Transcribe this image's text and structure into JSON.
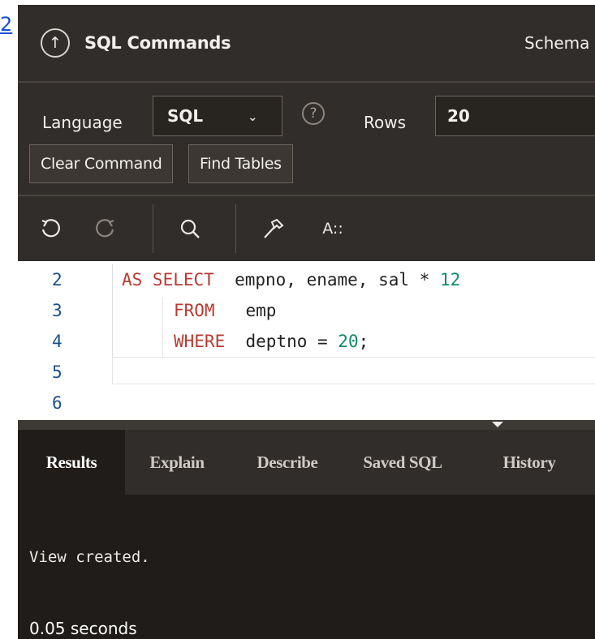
{
  "page_fragment": "2",
  "header": {
    "title": "SQL Commands",
    "schema_label": "Schema",
    "up_icon": "arrow-up-circle-icon"
  },
  "toolbar": {
    "language_label": "Language",
    "language_value": "SQL",
    "help_glyph": "?",
    "rows_label": "Rows",
    "rows_value": "20",
    "clear_command_label": "Clear Command",
    "find_tables_label": "Find Tables"
  },
  "editor_tools": {
    "undo_icon": "undo-icon",
    "redo_icon": "redo-icon",
    "search_icon": "search-icon",
    "format_icon": "hammer-icon",
    "autocomplete_label": "A::"
  },
  "editor": {
    "line_numbers": [
      "2",
      "3",
      "4",
      "5",
      "6"
    ],
    "lines": [
      {
        "kw": "AS SELECT",
        "rest": "  empno, ename, sal * ",
        "num": "12",
        "tail": ""
      },
      {
        "kw": "FROM",
        "rest": "   emp",
        "num": "",
        "tail": ""
      },
      {
        "kw": "WHERE",
        "rest": "  deptno = ",
        "num": "20",
        "tail": ";"
      }
    ]
  },
  "results_tabs": [
    "Results",
    "Explain",
    "Describe",
    "Saved SQL",
    "History"
  ],
  "results": {
    "message": "View created.",
    "elapsed": "0.05 seconds"
  },
  "colors": {
    "background": "#312d2a",
    "results_background": "#1f1c19",
    "keyword": "#b83a32",
    "number": "#0e8a6a",
    "line_number": "#1b4f8f"
  }
}
